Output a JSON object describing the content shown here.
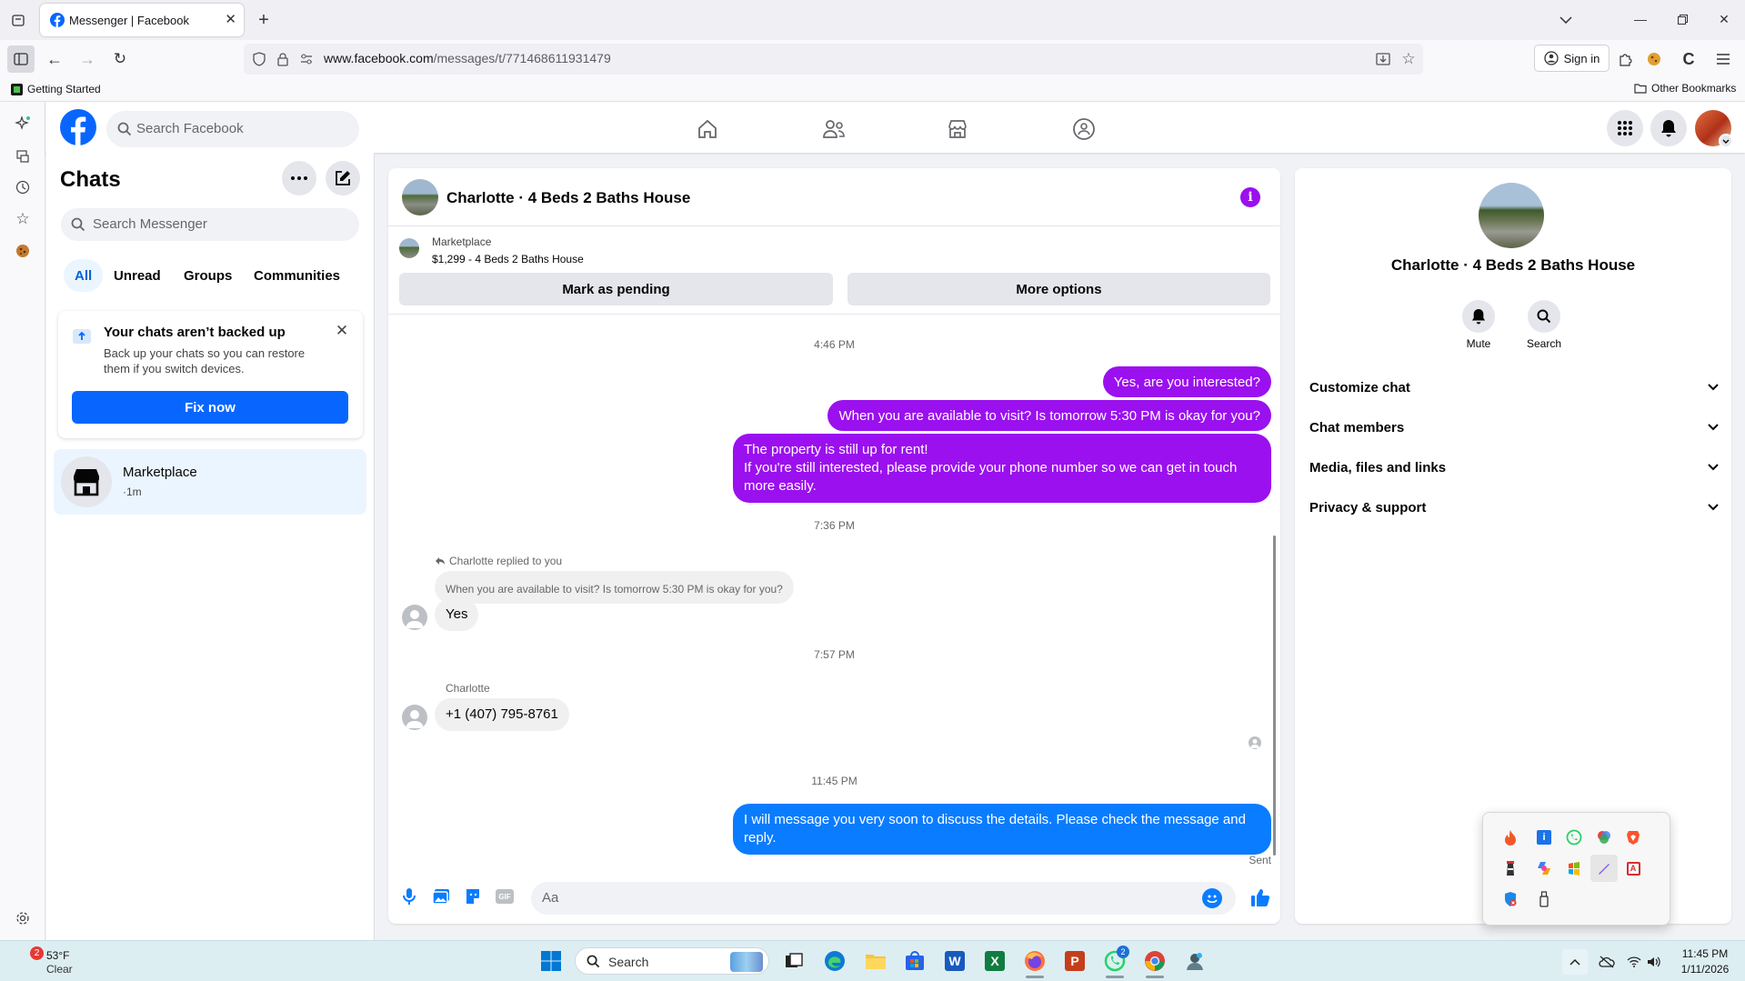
{
  "browser": {
    "tab_title": "Messenger | Facebook",
    "url_domain": "www.facebook.com",
    "url_path": "/messages/t/771468611931479",
    "sign_in": "Sign in",
    "bookmark_getting_started": "Getting Started",
    "bookmark_other": "Other Bookmarks"
  },
  "header": {
    "search_placeholder": "Search Facebook"
  },
  "chats": {
    "title": "Chats",
    "search_placeholder": "Search Messenger",
    "filters": [
      "All",
      "Unread",
      "Groups",
      "Communities"
    ],
    "backup_title": "Your chats aren’t backed up",
    "backup_body": "Back up your chats so you can restore them if you switch devices.",
    "fix_now": "Fix now",
    "list": [
      {
        "name": "Marketplace",
        "meta": "·1m"
      }
    ]
  },
  "conversation": {
    "title": "Charlotte · 4 Beds 2 Baths House",
    "listing_source": "Marketplace",
    "listing_text": "$1,299 - 4 Beds 2 Baths House",
    "mark_pending": "Mark as pending",
    "more_options": "More options",
    "time1": "4:46 PM",
    "msg_out1": "Yes, are you interested?",
    "msg_out2": "When you are available to visit? Is tomorrow 5:30 PM is okay for you?",
    "msg_out3_line1": "The property is still up for rent!",
    "msg_out3_line2": "If you're still interested, please provide your phone number so we can get in touch more easily.",
    "time2": "7:36 PM",
    "reply_label": "Charlotte replied to you",
    "reply_quote": "When you are available to visit? Is tomorrow 5:30 PM is okay for you?",
    "msg_in1": "Yes",
    "time3": "7:57 PM",
    "sender_name": "Charlotte",
    "msg_in2": "+1 (407) 795-8761",
    "time4": "11:45 PM",
    "msg_out4": "I will message you very soon to discuss the details. Please check the message and reply.",
    "sent_status": "Sent",
    "composer_placeholder": "Aa",
    "accent_color": "#9b10ee"
  },
  "info_panel": {
    "name": "Charlotte · 4 Beds 2 Baths House",
    "mute": "Mute",
    "search": "Search",
    "sections": [
      "Customize chat",
      "Chat members",
      "Media, files and links",
      "Privacy & support"
    ]
  },
  "taskbar": {
    "weather_temp": "53°F",
    "weather_cond": "Clear",
    "weather_badge": "2",
    "search": "Search",
    "whatsapp_badge": "2",
    "time": "11:45 PM",
    "date": "1/11/2026"
  }
}
